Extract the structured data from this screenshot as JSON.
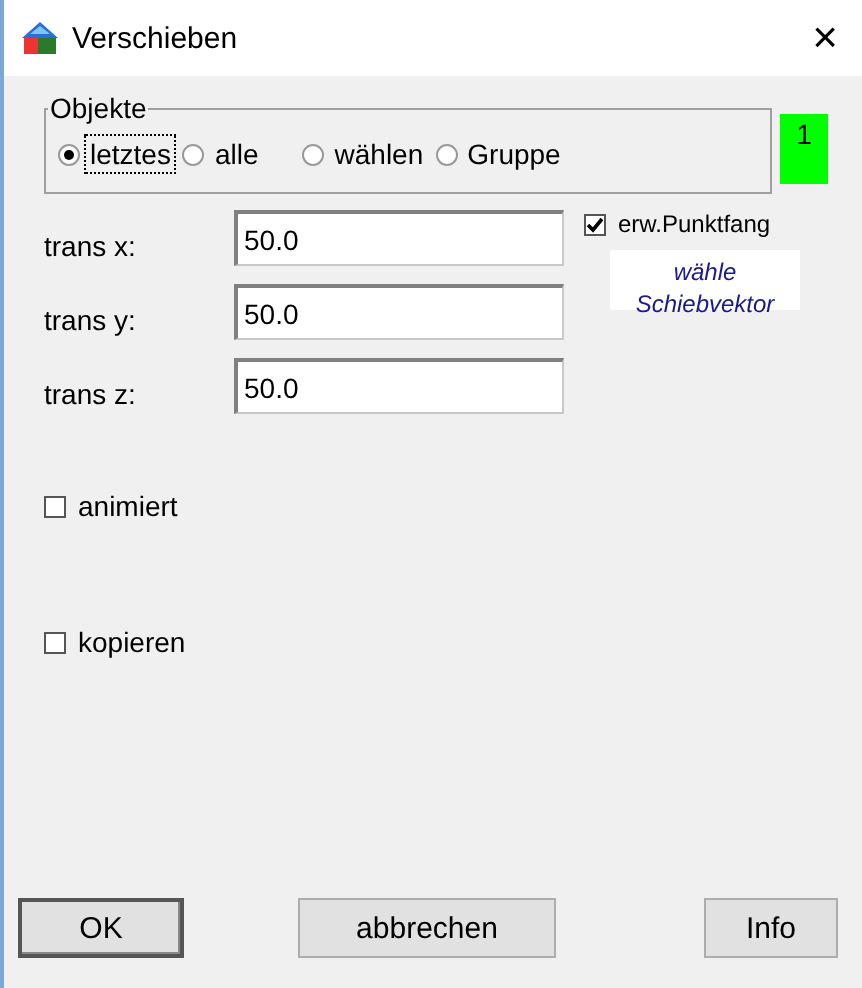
{
  "window": {
    "title": "Verschieben",
    "close": "×"
  },
  "objects_group": {
    "label": "Objekte",
    "options": [
      {
        "label": "letztes",
        "selected": true,
        "focused": true
      },
      {
        "label": "alle",
        "selected": false,
        "focused": false
      },
      {
        "label": "wählen",
        "selected": false,
        "focused": false
      },
      {
        "label": "Gruppe",
        "selected": false,
        "focused": false
      }
    ],
    "count": "1"
  },
  "translations": [
    {
      "label": "trans x:",
      "value": "50.0"
    },
    {
      "label": "trans y:",
      "value": "50.0"
    },
    {
      "label": "trans z:",
      "value": "50.0"
    }
  ],
  "snap": {
    "label": "erw.Punktfang",
    "checked": true
  },
  "pick_vector_button": {
    "label_lines": [
      "wähle",
      "Schiebvektor"
    ]
  },
  "options": [
    {
      "label": "animiert",
      "checked": false
    },
    {
      "label": "kopieren",
      "checked": false
    }
  ],
  "buttons": [
    {
      "label": "OK",
      "default": true
    },
    {
      "label": "abbrechen",
      "default": false
    },
    {
      "label": "Info",
      "default": false
    }
  ]
}
